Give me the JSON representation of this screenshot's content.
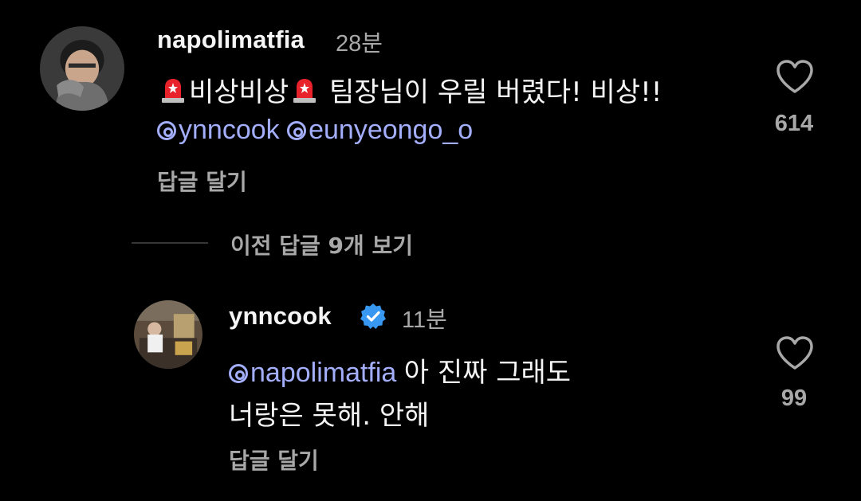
{
  "colors": {
    "background": "#000000",
    "text": "#f5f5f5",
    "secondary": "#a8a8a8",
    "mention": "#a3aefc",
    "verified": "#3897f0",
    "siren": "#e8222a"
  },
  "comments": [
    {
      "username": "napolimatfia",
      "time": "28분",
      "text_part1": "비상비상",
      "text_part2": "팀장님이 우릴 버렸다! 비상!!",
      "emoji": "police-car-light",
      "mentions": [
        "ynncook",
        "eunyeongo_o"
      ],
      "reply_label": "답글 달기",
      "likes": "614",
      "avatar": "avatar-photo"
    }
  ],
  "view_previous_replies": "이전 답글 9개 보기",
  "reply": {
    "username": "ynncook",
    "verified": true,
    "time": "11분",
    "mention": "napolimatfia",
    "text_line1": "아 진짜 그래도",
    "text_line2": "너랑은 못해. 안해",
    "reply_label": "답글 달기",
    "likes": "99",
    "avatar": "avatar-photo"
  }
}
